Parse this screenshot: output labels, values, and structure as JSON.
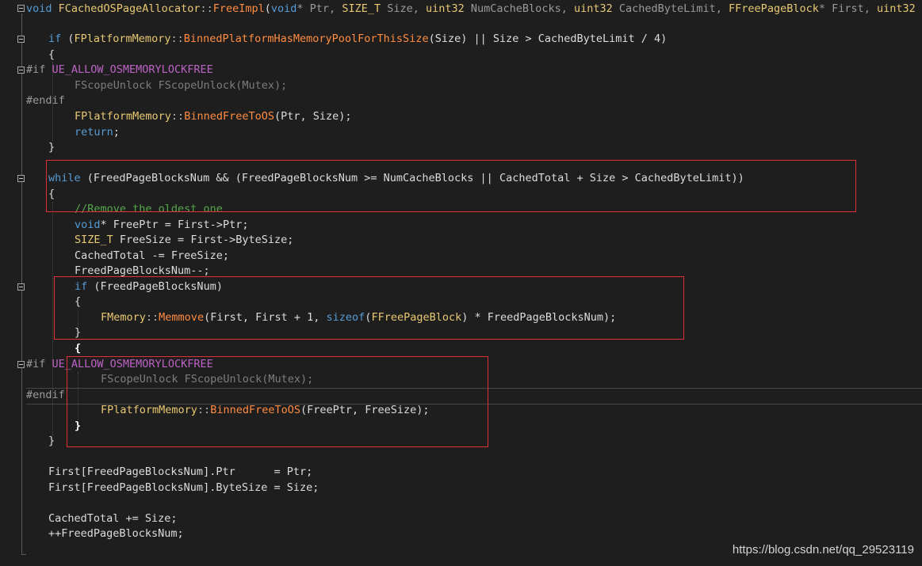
{
  "code": {
    "l1": {
      "a": "void ",
      "b": "FCachedOSPageAllocator",
      "c": "::",
      "d": "FreeImpl",
      "e": "(",
      "f": "void",
      "g": "* Ptr, ",
      "h": "SIZE_T",
      "i": " Size, ",
      "j": "uint32",
      "k": " NumCacheBlocks, ",
      "l": "uint32",
      "m": " CachedByteLimit, ",
      "n": "FFreePageBlock",
      "o": "* First, ",
      "p": "uint32"
    },
    "l3": {
      "a": "if",
      "b": " (",
      "c": "FPlatformMemory",
      "d": "::",
      "e": "BinnedPlatformHasMemoryPoolForThisSize",
      "f": "(Size) || Size > CachedByteLimit / 4)"
    },
    "l4": {
      "a": "{"
    },
    "l5": {
      "a": "#if ",
      "b": "UE_ALLOW_OSMEMORYLOCKFREE"
    },
    "l6": {
      "a": "FScopeUnlock FScopeUnlock(Mutex);"
    },
    "l7": {
      "a": "#endif"
    },
    "l8": {
      "a": "FPlatformMemory",
      "b": "::",
      "c": "BinnedFreeToOS",
      "d": "(Ptr, Size);"
    },
    "l9": {
      "a": "return",
      "b": ";"
    },
    "l10": {
      "a": "}"
    },
    "l12": {
      "a": "while",
      "b": " (FreedPageBlocksNum && (FreedPageBlocksNum >= NumCacheBlocks || CachedTotal + Size > CachedByteLimit))"
    },
    "l13": {
      "a": "{"
    },
    "l14": {
      "a": "//Remove the oldest one"
    },
    "l15": {
      "a": "void",
      "b": "* FreePtr = First->Ptr;"
    },
    "l16": {
      "a": "SIZE_T",
      "b": " FreeSize = First->ByteSize;"
    },
    "l17": {
      "a": "CachedTotal -= FreeSize;"
    },
    "l18": {
      "a": "FreedPageBlocksNum--;"
    },
    "l19": {
      "a": "if",
      "b": " (FreedPageBlocksNum)"
    },
    "l20": {
      "a": "{"
    },
    "l21": {
      "a": "FMemory",
      "b": "::",
      "c": "Memmove",
      "d": "(First, First + 1, ",
      "e": "sizeof",
      "f": "(",
      "g": "FFreePageBlock",
      "h": ") * FreedPageBlocksNum);"
    },
    "l22": {
      "a": "}"
    },
    "l23": {
      "a": "{"
    },
    "l24": {
      "a": "#if ",
      "b": "UE_ALLOW_OSMEMORYLOCKFREE"
    },
    "l25": {
      "a": "FScopeUnlock FScopeUnlock(Mutex);"
    },
    "l26": {
      "a": "#endif"
    },
    "l27": {
      "a": "FPlatformMemory",
      "b": "::",
      "c": "BinnedFreeToOS",
      "d": "(FreePtr, FreeSize);"
    },
    "l28": {
      "a": "}"
    },
    "l29": {
      "a": "}"
    },
    "l31": {
      "a": "First[FreedPageBlocksNum].Ptr      = Ptr;"
    },
    "l32": {
      "a": "First[FreedPageBlocksNum].ByteSize = Size;"
    },
    "l34": {
      "a": "CachedTotal += Size;"
    },
    "l35": {
      "a": "++FreedPageBlocksNum;"
    }
  },
  "watermark": "https://blog.csdn.net/qq_29523119"
}
